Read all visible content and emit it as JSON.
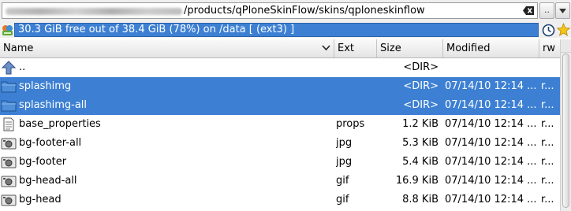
{
  "pathbar": {
    "path_suffix": "/products/qPloneSkinFlow/skins/qploneskinflow",
    "up_button_label": ".."
  },
  "status": {
    "text": "30.3 GiB free out of 38.4 GiB (78%) on /data [ (ext3) ]"
  },
  "columns": {
    "name": "Name",
    "ext": "Ext",
    "size": "Size",
    "modified": "Modified",
    "rw": "rw"
  },
  "rows": [
    {
      "name": "..",
      "ext": "",
      "size": "<DIR>",
      "modified": "",
      "rw": "",
      "icon": "up-arrow-icon",
      "selected": false
    },
    {
      "name": "splashimg",
      "ext": "",
      "size": "<DIR>",
      "modified": "07/14/10 12:14 ...",
      "rw": "r...",
      "icon": "folder-icon",
      "selected": true
    },
    {
      "name": "splashimg-all",
      "ext": "",
      "size": "<DIR>",
      "modified": "07/14/10 12:14 ...",
      "rw": "r...",
      "icon": "folder-icon",
      "selected": true
    },
    {
      "name": "base_properties",
      "ext": "props",
      "size": "1.2 KiB",
      "modified": "07/14/10 12:14 ...",
      "rw": "r...",
      "icon": "text-file-icon",
      "selected": false
    },
    {
      "name": "bg-footer-all",
      "ext": "jpg",
      "size": "5.3 KiB",
      "modified": "07/14/10 12:14 ...",
      "rw": "r...",
      "icon": "image-file-icon",
      "selected": false
    },
    {
      "name": "bg-footer",
      "ext": "jpg",
      "size": "5.4 KiB",
      "modified": "07/14/10 12:14 ...",
      "rw": "r...",
      "icon": "image-file-icon",
      "selected": false
    },
    {
      "name": "bg-head-all",
      "ext": "gif",
      "size": "16.9 KiB",
      "modified": "07/14/10 12:14 ...",
      "rw": "r...",
      "icon": "image-file-icon",
      "selected": false
    },
    {
      "name": "bg-head",
      "ext": "gif",
      "size": "8.8 KiB",
      "modified": "07/14/10 12:14 ...",
      "rw": "r...",
      "icon": "image-file-icon",
      "selected": false
    }
  ],
  "colors": {
    "selection": "#3d80d3",
    "status_bg": "#3d80d3"
  }
}
